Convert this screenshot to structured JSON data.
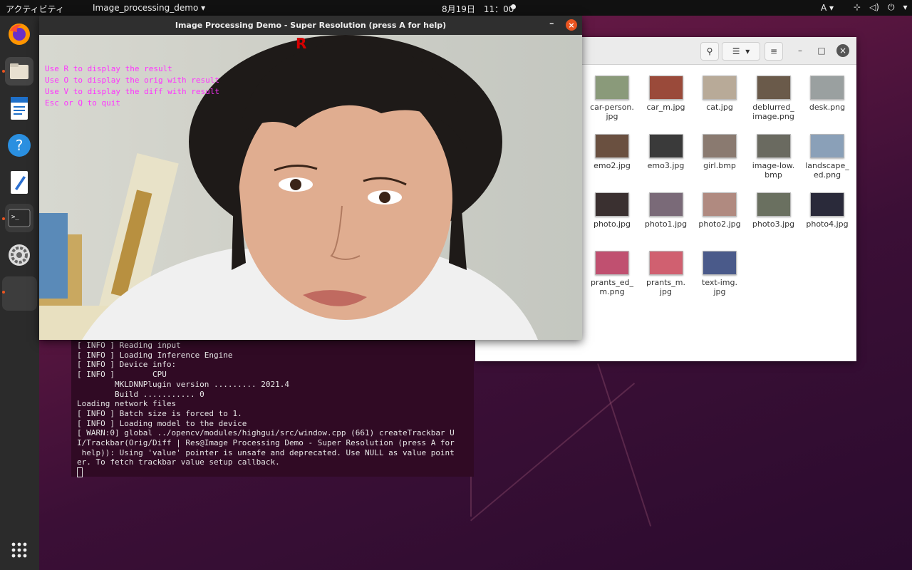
{
  "topbar": {
    "activities": "アクティビティ",
    "app_menu": "Image_processing_demo",
    "clock": "8月19日　11：00",
    "input_method": "A",
    "tray_network_icon": "network-icon",
    "tray_volume_icon": "volume-icon",
    "tray_power_icon": "power-icon"
  },
  "image_window": {
    "title": "Image Processing Demo - Super Resolution (press A for help)",
    "minimize_label": "–",
    "close_label": "×",
    "mode_marker": "R",
    "help_lines": [
      "Use R to display the result",
      "Use O to display the orig with result",
      "Use V to display the diff with result",
      "Esc or Q to quit"
    ]
  },
  "files": {
    "items": [
      {
        "name": "car-person.\njpg",
        "color": "#8a9a7a"
      },
      {
        "name": "car_m.jpg",
        "color": "#9a4a3a"
      },
      {
        "name": "cat.jpg",
        "color": "#b8aa98"
      },
      {
        "name": "deblurred_\nimage.png",
        "color": "#6a5a4a"
      },
      {
        "name": "desk.png",
        "color": "#9aa0a0"
      },
      {
        "name": "emo2.jpg",
        "color": "#6a5040"
      },
      {
        "name": "emo3.jpg",
        "color": "#3a3a3a"
      },
      {
        "name": "girl.bmp",
        "color": "#8a7a70"
      },
      {
        "name": "image-low.\nbmp",
        "color": "#6a6a60"
      },
      {
        "name": "landscape_\ned.png",
        "color": "#8aa0b8"
      },
      {
        "name": "photo.jpg",
        "color": "#3a3030"
      },
      {
        "name": "photo1.jpg",
        "color": "#7a6a78"
      },
      {
        "name": "photo2.jpg",
        "color": "#b08a80"
      },
      {
        "name": "photo3.jpg",
        "color": "#6a7060"
      },
      {
        "name": "photo4.jpg",
        "color": "#2a2a3a"
      },
      {
        "name": "prants_ed_\nm.png",
        "color": "#c05070"
      },
      {
        "name": "prants_m.\njpg",
        "color": "#d06070"
      },
      {
        "name": "text-img.\njpg",
        "color": "#4a5a8a"
      }
    ]
  },
  "terminal": {
    "lines": [
      "[ INFO ] Reading input",
      "[ INFO ] Loading Inference Engine",
      "[ INFO ] Device info:",
      "[ INFO ]        CPU",
      "        MKLDNNPlugin version ......... 2021.4",
      "        Build ........... 0",
      "Loading network files",
      "[ INFO ] Batch size is forced to 1.",
      "[ INFO ] Loading model to the device",
      "[ WARN:0] global ../opencv/modules/highgui/src/window.cpp (661) createTrackbar U",
      "I/Trackbar(Orig/Diff | Res@Image Processing Demo - Super Resolution (press A for",
      " help)): Using 'value' pointer is unsafe and deprecated. Use NULL as value point",
      "er. To fetch trackbar value setup callback."
    ]
  },
  "colors": {
    "accent": "#e95420",
    "terminal_bg": "#300a24",
    "overlay_text": "#ff33ff"
  }
}
